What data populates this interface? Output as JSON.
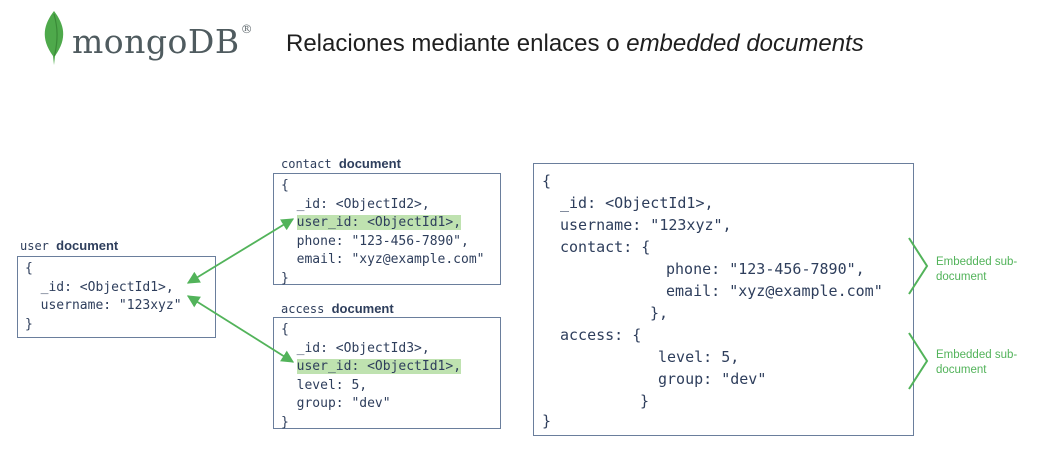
{
  "header": {
    "logo_text": "mongoDB",
    "logo_mark": "®",
    "title_plain": "Relaciones mediante enlaces o ",
    "title_italic": "embedded documents"
  },
  "user_doc": {
    "label_prefix": "user",
    "label_word": "document",
    "lines": [
      "{",
      "  _id: <ObjectId1>,",
      "  username: \"123xyz\"",
      "}"
    ]
  },
  "contact_doc": {
    "label_prefix": "contact",
    "label_word": "document",
    "lines": [
      "{",
      "  _id: <ObjectId2>,",
      "  user_id: <ObjectId1>,",
      "  phone: \"123-456-7890\",",
      "  email: \"xyz@example.com\"",
      "}"
    ]
  },
  "access_doc": {
    "label_prefix": "access",
    "label_word": "document",
    "lines": [
      "{",
      "  _id: <ObjectId3>,",
      "  user_id: <ObjectId1>,",
      "  level: 5,",
      "  group: \"dev\"",
      "}"
    ]
  },
  "embedded_doc": {
    "lines": [
      "{",
      "_id: <ObjectId1>,",
      "username: \"123xyz\",",
      "contact: {",
      "phone: \"123-456-7890\",",
      "email: \"xyz@example.com\"",
      "},",
      "access: {",
      "level: 5,",
      "group: \"dev\"",
      "}",
      "}"
    ],
    "annotation_1": "Embedded sub-document",
    "annotation_2": "Embedded sub-document"
  },
  "colors": {
    "accent_green": "#52b35a",
    "highlight": "#bfe2b0",
    "border": "#6a7e9c",
    "text": "#2e3e5c"
  }
}
